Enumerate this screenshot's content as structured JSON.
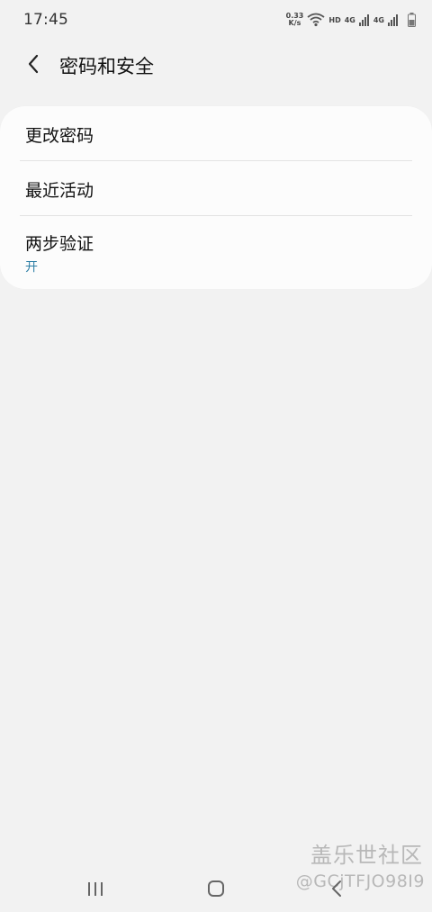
{
  "status_bar": {
    "time": "17:45",
    "speed_value": "0.33",
    "speed_unit": "K/s",
    "hd": "HD",
    "network1": "4G",
    "network2": "4G",
    "icons": [
      "wifi-icon",
      "signal-icon",
      "signal-icon",
      "battery-icon"
    ]
  },
  "header": {
    "back_icon": "chevron-left-icon",
    "title": "密码和安全"
  },
  "menu": {
    "items": [
      {
        "label": "更改密码"
      },
      {
        "label": "最近活动"
      },
      {
        "label": "两步验证",
        "status": "开"
      }
    ],
    "status_color": "#2e7fa6"
  },
  "watermark": {
    "logo": "盖乐世社区",
    "user": "@GCjTFJO98I9"
  },
  "nav_bar": {
    "icons": [
      "recents-icon",
      "home-icon",
      "back-icon"
    ]
  }
}
